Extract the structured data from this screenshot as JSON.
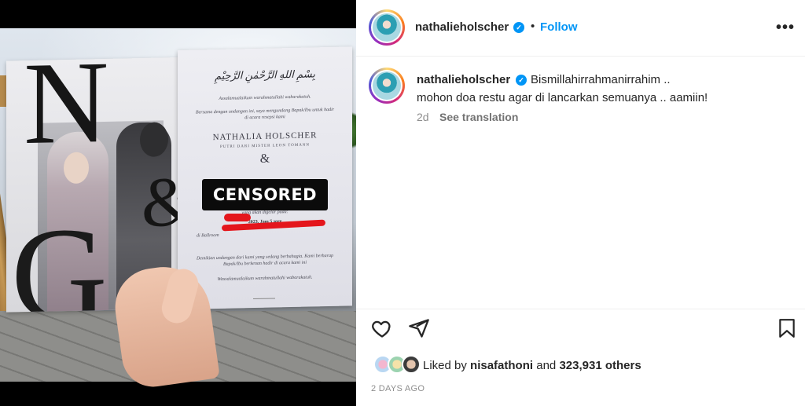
{
  "header": {
    "username": "nathalieholscher",
    "follow_label": "Follow",
    "separator": "•",
    "more_label": "•••"
  },
  "caption": {
    "username": "nathalieholscher",
    "line1": "Bismillahirrahmanirrahim ..",
    "line2": "mohon doa restu agar di lancarkan semuanya .. aamiin!",
    "time": "2d",
    "see_translation": "See translation"
  },
  "likes": {
    "prefix": "Liked by",
    "user": "nisafathoni",
    "middle": "and",
    "count": "323,931 others"
  },
  "posted": "2 DAYS AGO",
  "invitation": {
    "arabic": "بِسْمِ اللهِ الرَّحْمٰنِ الرَّحِيْمِ",
    "greeting": "Assalamualaikum warahmatullahi wabarakatuh.",
    "intro": "Bersama dengan undangan ini, saya mengundang Bapak/Ibu untuk hadir di acara resepsi kami",
    "bride": "NATHALIA HOLSCHER",
    "bride_sub": "PUTRI DARI MISTER LEON TOMANN",
    "ampersand": "&",
    "date_line": "yang akan digelar pada:",
    "time_line": "2023, Jam 5 sore",
    "venue": "di Ballroom",
    "closing": "Demikian undangan dari kami yang sedang berbahagia. Kami berharap Bapak/Ibu berkenan hadir di acara kami ini",
    "wassalam": "Wassalamualaikum warahmatullahi wabarakatuh.",
    "censor_label": "CENSORED",
    "letter_n": "N",
    "letter_g": "G",
    "big_amp": "&"
  },
  "colors": {
    "accent": "#0095f6",
    "text": "#262626",
    "muted": "#8e8e8e",
    "censor_red": "#e4161c"
  },
  "icons": [
    "verified-badge-icon",
    "more-options-icon",
    "heart-icon",
    "share-icon",
    "bookmark-icon"
  ]
}
